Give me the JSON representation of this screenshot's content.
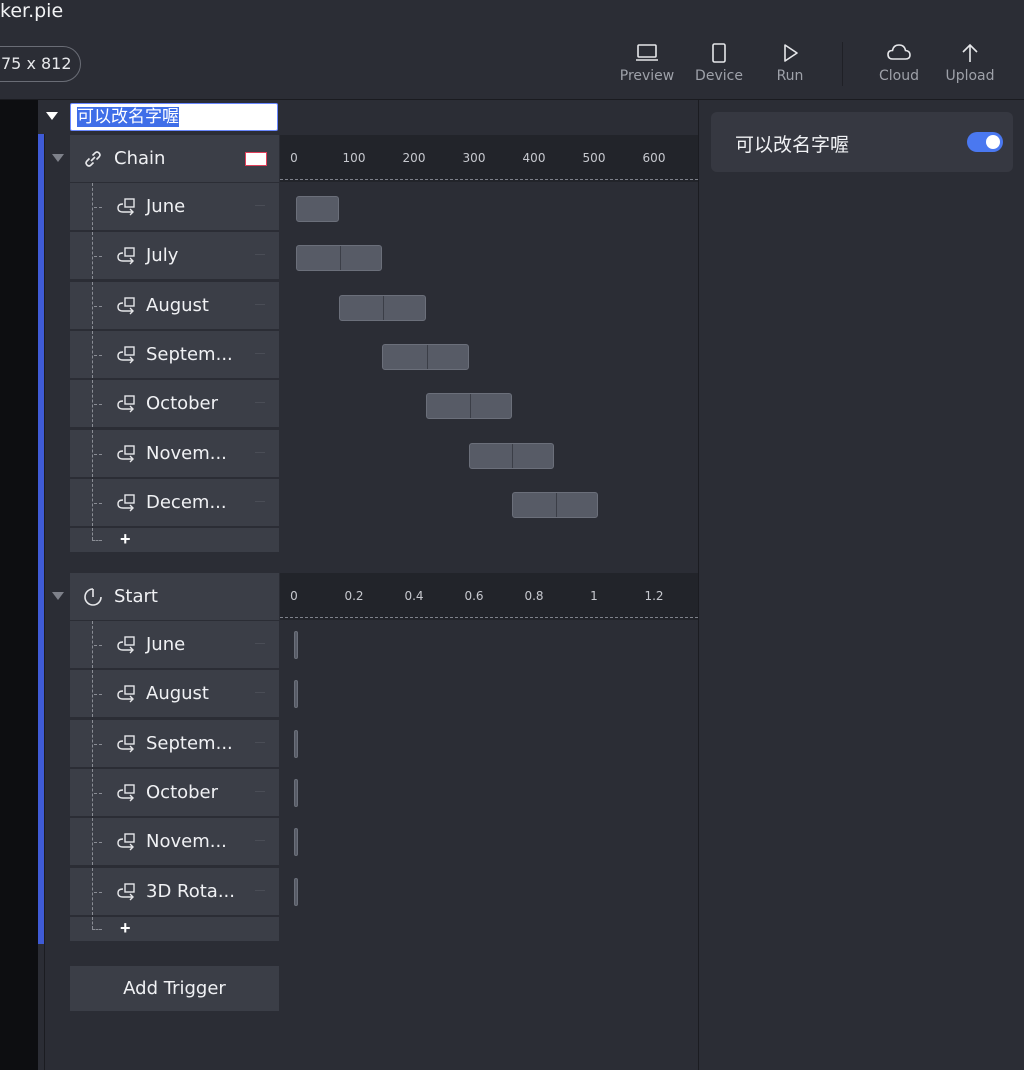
{
  "header": {
    "doc_title": "ker.pie",
    "canvas_size": "75 x 812",
    "toolbar": [
      {
        "label": "Preview",
        "icon": "laptop-icon"
      },
      {
        "label": "Device",
        "icon": "phone-icon"
      },
      {
        "label": "Run",
        "icon": "play-icon"
      },
      {
        "label": "Cloud",
        "icon": "cloud-icon"
      },
      {
        "label": "Upload",
        "icon": "upload-arrow-icon"
      }
    ]
  },
  "layer": {
    "name": "可以改名字喔"
  },
  "triggers": [
    {
      "label": "Chain",
      "icon": "link-icon",
      "swatch_color": "#ffffff",
      "ruler": {
        "ticks": [
          "0",
          "100",
          "200",
          "300",
          "400",
          "500",
          "600"
        ],
        "min": 0,
        "max": 700
      },
      "items": [
        {
          "label": "June",
          "start": 0,
          "end": 72
        },
        {
          "label": "July",
          "start": 0,
          "end": 144
        },
        {
          "label": "August",
          "start": 72,
          "end": 216
        },
        {
          "label": "Septem...",
          "start": 144,
          "end": 288
        },
        {
          "label": "October",
          "start": 216,
          "end": 360
        },
        {
          "label": "Novem...",
          "start": 288,
          "end": 430
        },
        {
          "label": "Decem...",
          "start": 360,
          "end": 504
        }
      ],
      "add_label": "+"
    },
    {
      "label": "Start",
      "icon": "power-icon",
      "ruler": {
        "ticks": [
          "0",
          "0.2",
          "0.4",
          "0.6",
          "0.8",
          "1",
          "1.2"
        ],
        "min": 0,
        "max": 1.4
      },
      "items": [
        {
          "label": "June"
        },
        {
          "label": "August"
        },
        {
          "label": "Septem..."
        },
        {
          "label": "October"
        },
        {
          "label": "Novem..."
        },
        {
          "label": "3D Rota..."
        }
      ],
      "add_label": "+"
    }
  ],
  "add_trigger_label": "Add Trigger",
  "right_panel": {
    "prop_label": "可以改名字喔",
    "toggle_on": true,
    "accent": "#4a78f0"
  },
  "colors": {
    "selection": "#3f5bd6",
    "swatch_border": "#e03f5a"
  }
}
